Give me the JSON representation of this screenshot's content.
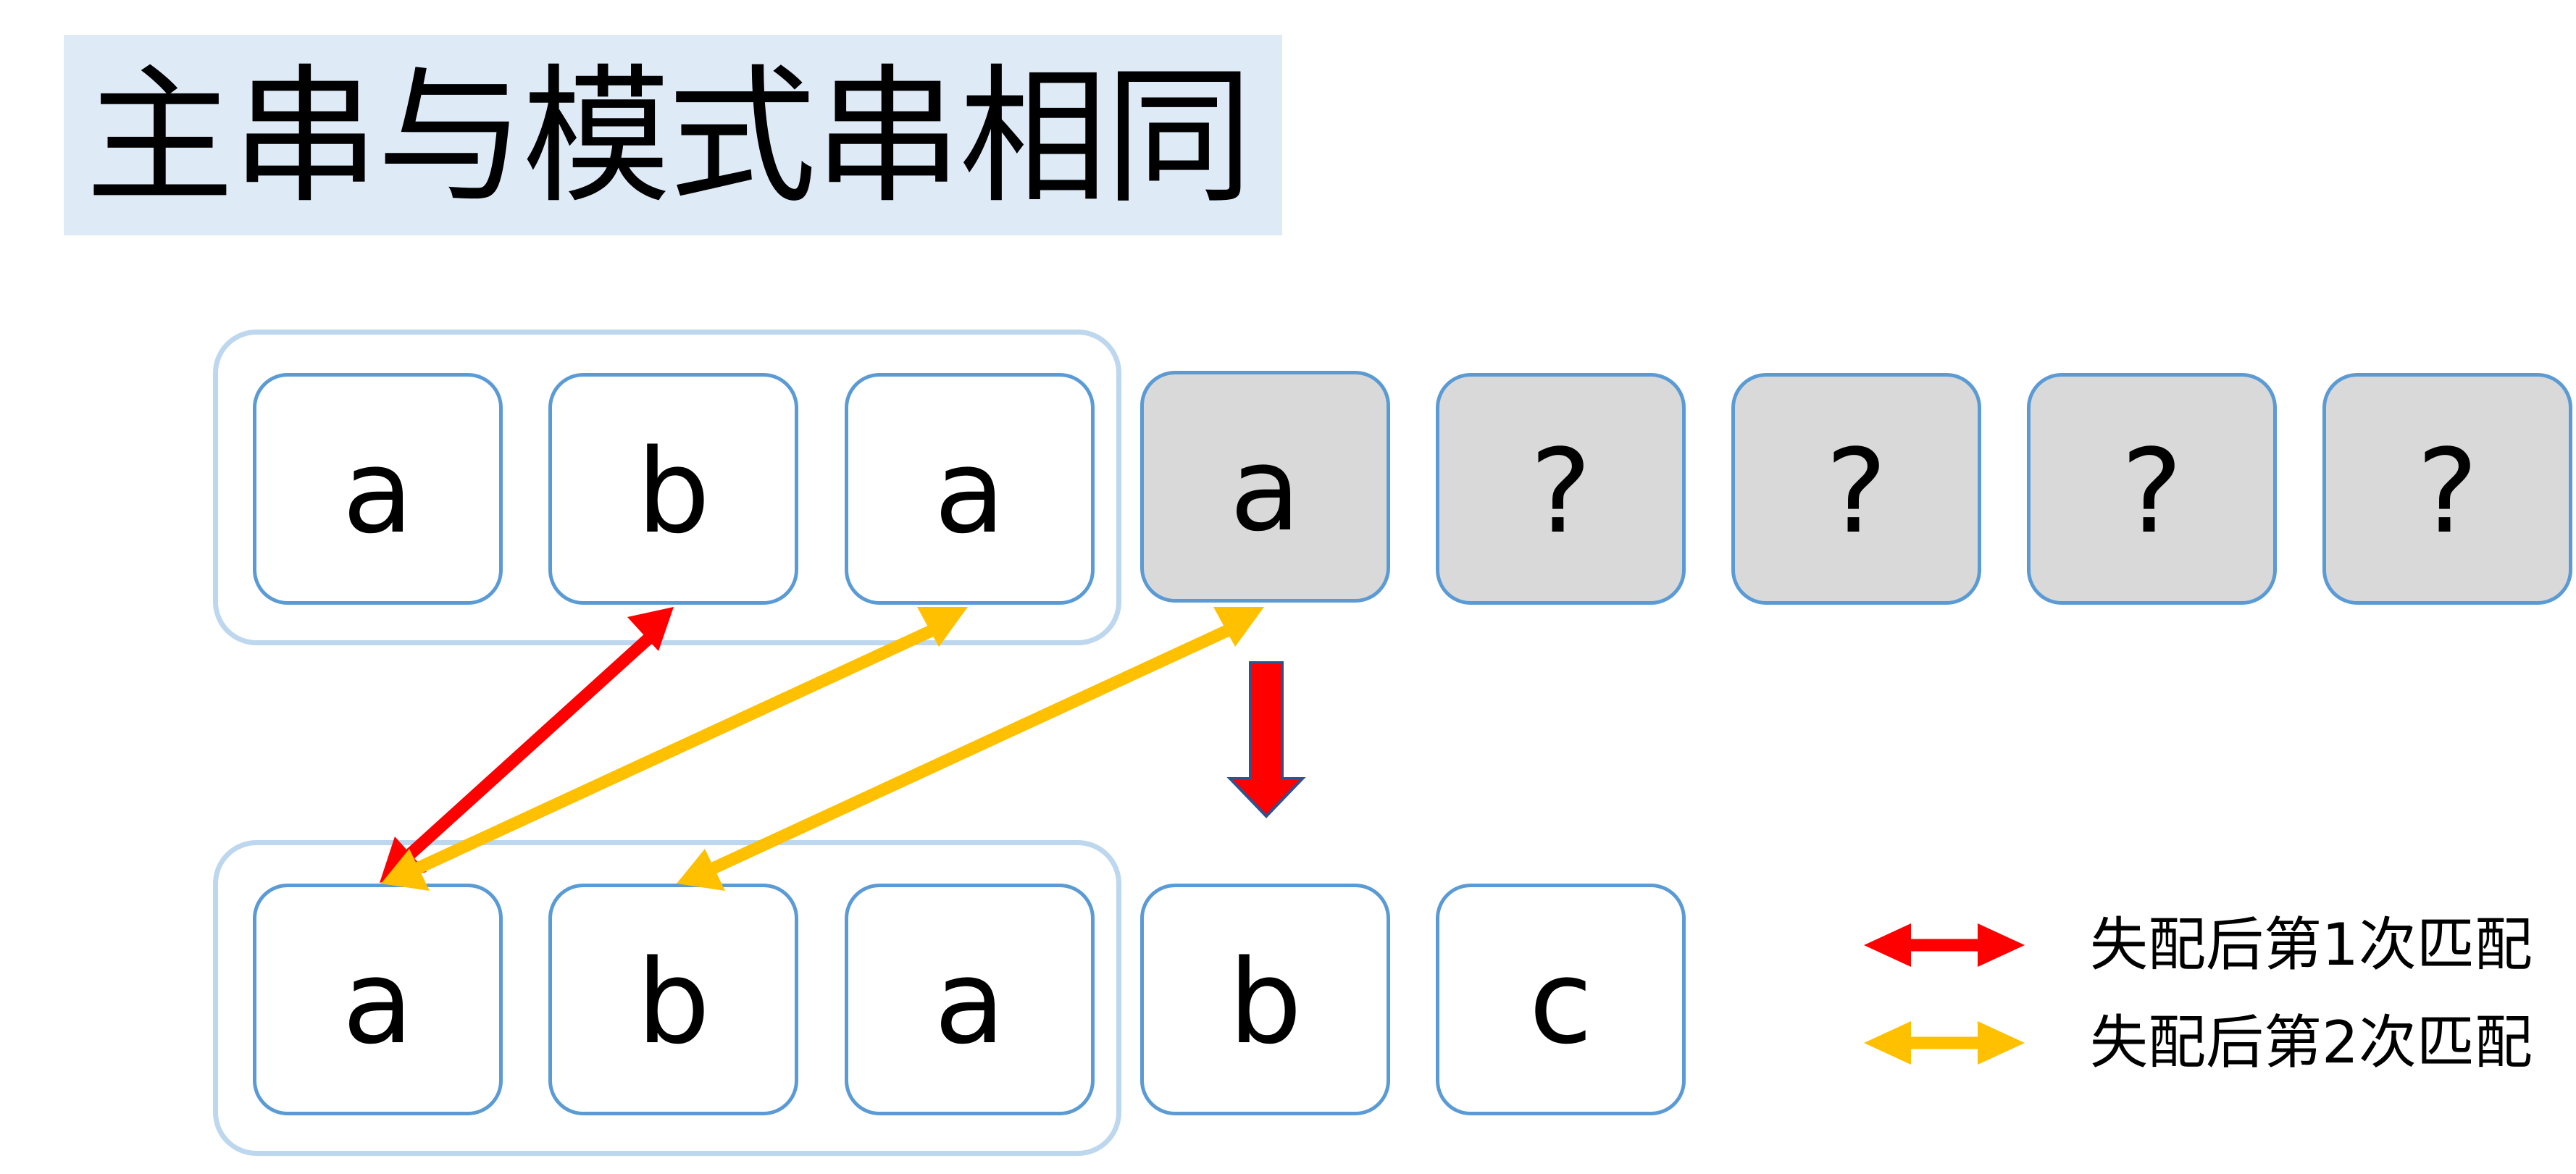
{
  "title": "主串与模式串相同",
  "main_string": [
    "a",
    "b",
    "a",
    "a",
    "?",
    "?",
    "?",
    "?"
  ],
  "pattern_string": [
    "a",
    "b",
    "a",
    "b",
    "c"
  ],
  "legend": [
    {
      "label": "失配后第1次匹配",
      "color": "#FF0000"
    },
    {
      "label": "失配后第2次匹配",
      "color": "#FFC000"
    }
  ],
  "colors": {
    "title_bg": "#DEEBF7",
    "cell_border": "#5B9BD5",
    "group_frame": "#BDD7EE",
    "unknown_fill": "#D9D9D9",
    "first_match": "#FF0000",
    "second_match": "#FFC000"
  }
}
